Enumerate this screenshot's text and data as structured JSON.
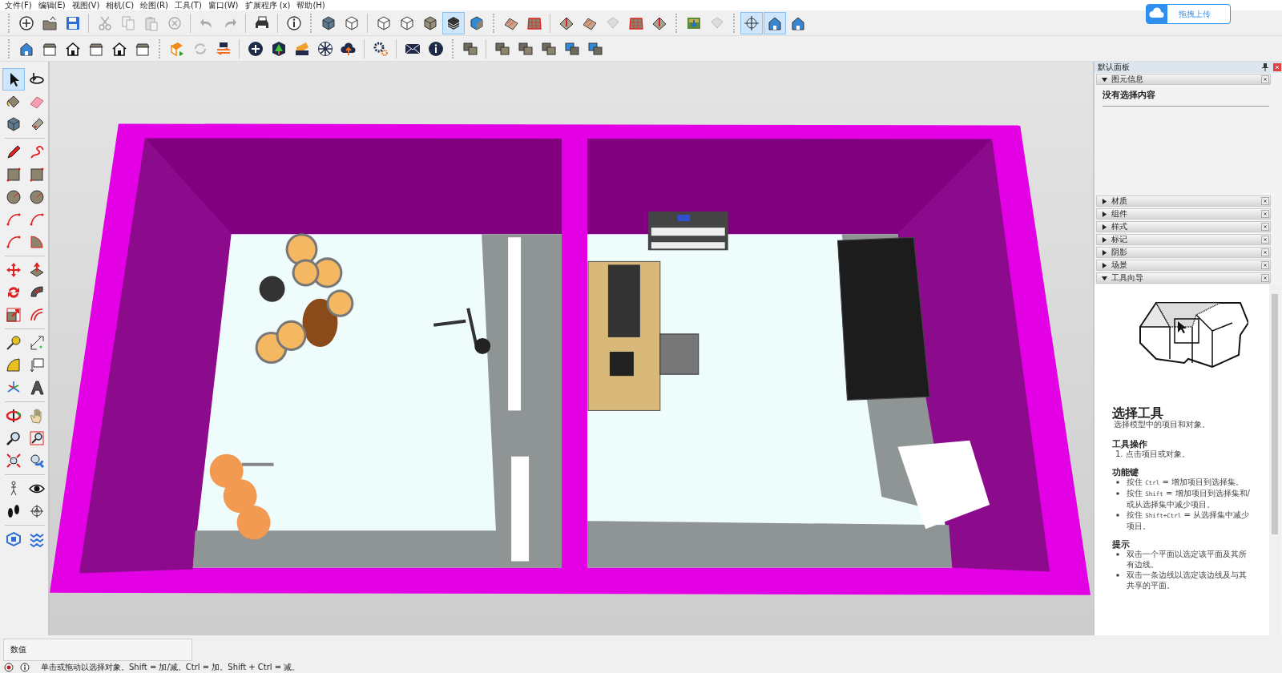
{
  "menu_bar": [
    {
      "label": "文件(F)"
    },
    {
      "label": "编辑(E)"
    },
    {
      "label": "视图(V)"
    },
    {
      "label": "相机(C)"
    },
    {
      "label": "绘图(R)"
    },
    {
      "label": "工具(T)"
    },
    {
      "label": "窗口(W)"
    },
    {
      "label": "扩展程序 (x)"
    },
    {
      "label": "帮助(H)"
    }
  ],
  "upload_button": {
    "label": "拖拽上传"
  },
  "toolbar_top": [
    {
      "selected": false
    },
    {
      "selected": false
    },
    {
      "selected": false
    },
    {
      "selected": false
    },
    {
      "selected": false
    },
    {
      "selected": false
    },
    {
      "selected": false
    },
    {
      "selected": false
    },
    {
      "selected": false
    },
    {
      "selected": false
    },
    {
      "selected": false
    },
    {
      "selected": false
    },
    {
      "selected": false
    },
    {
      "selected": false
    },
    {
      "selected": false
    },
    {
      "selected": false
    },
    {
      "selected": true
    },
    {
      "selected": false
    },
    {
      "selected": false
    },
    {
      "selected": false
    },
    {
      "selected": false
    },
    {
      "selected": false
    },
    {
      "selected": false
    },
    {
      "selected": false
    },
    {
      "selected": false
    },
    {
      "selected": false
    },
    {
      "selected": false
    },
    {
      "selected": true
    },
    {
      "selected": true
    },
    {
      "selected": false
    }
  ],
  "toolbar_bottom": [
    {
      "selected": false
    },
    {
      "selected": false
    },
    {
      "selected": false
    },
    {
      "selected": false
    },
    {
      "selected": false
    },
    {
      "selected": false
    },
    {
      "selected": false
    },
    {
      "selected": false
    },
    {
      "selected": false
    },
    {
      "selected": false
    },
    {
      "selected": false
    },
    {
      "selected": false
    },
    {
      "selected": false
    },
    {
      "selected": false
    },
    {
      "selected": false
    },
    {
      "selected": false
    },
    {
      "selected": false
    },
    {
      "selected": false
    },
    {
      "selected": false
    },
    {
      "selected": false
    },
    {
      "selected": false
    },
    {
      "selected": false
    },
    {
      "selected": false
    }
  ],
  "tool_palette": [
    {
      "selected": true
    },
    {
      "selected": false
    },
    {
      "selected": false
    },
    {
      "selected": false
    },
    {
      "selected": false
    },
    {
      "selected": false
    },
    {
      "selected": false
    },
    {
      "selected": false
    },
    {
      "selected": false
    },
    {
      "selected": false
    },
    {
      "selected": false
    },
    {
      "selected": false
    },
    {
      "selected": false
    },
    {
      "selected": false
    },
    {
      "selected": false
    },
    {
      "selected": false
    },
    {
      "selected": false
    },
    {
      "selected": false
    },
    {
      "selected": false
    },
    {
      "selected": false
    },
    {
      "selected": false
    },
    {
      "selected": false
    },
    {
      "selected": false
    },
    {
      "selected": false
    },
    {
      "selected": false
    },
    {
      "selected": false
    },
    {
      "selected": false
    },
    {
      "selected": false
    },
    {
      "selected": false
    },
    {
      "selected": false
    },
    {
      "selected": false
    },
    {
      "selected": false
    },
    {
      "selected": false
    },
    {
      "selected": false
    },
    {
      "selected": false
    },
    {
      "selected": false
    },
    {
      "selected": false
    },
    {
      "selected": false
    },
    {
      "selected": false
    },
    {
      "selected": false
    }
  ],
  "tray": {
    "title": "默认面板",
    "panels": [
      {
        "label": "图元信息",
        "expanded": true,
        "content": "没有选择内容"
      },
      {
        "label": "材质",
        "expanded": false
      },
      {
        "label": "组件",
        "expanded": false
      },
      {
        "label": "样式",
        "expanded": false
      },
      {
        "label": "标记",
        "expanded": false
      },
      {
        "label": "阴影",
        "expanded": false
      },
      {
        "label": "场景",
        "expanded": false
      },
      {
        "label": "工具向导",
        "expanded": true
      }
    ],
    "instructor": {
      "title": "选择工具",
      "subtitle": "选择模型中的项目和对象。",
      "sections": [
        {
          "heading": "工具操作",
          "kind": "numbered",
          "items": [
            {
              "text": "1. 点击项目或对象。"
            }
          ]
        },
        {
          "heading": "功能键",
          "kind": "bullets",
          "items": [
            {
              "pre": "按住 ",
              "key": "Ctrl",
              "post": " = 增加项目到选择集。"
            },
            {
              "pre": "按住 ",
              "key": "Shift",
              "post": " = 增加项目到选择集和/或从选择集中减少项目。"
            },
            {
              "pre": "按住 ",
              "key": "Shift+Ctrl",
              "post": " = 从选择集中减少项目。"
            }
          ]
        },
        {
          "heading": "提示",
          "kind": "bullets",
          "items": [
            {
              "text": "双击一个平面以选定该平面及其所有边线。"
            },
            {
              "text": "双击一条边线以选定该边线及与其共享的平面。"
            }
          ]
        }
      ]
    }
  },
  "value_box": {
    "label": "数值"
  },
  "status_bar": {
    "message": "单击或拖动以选择对象。Shift = 加/减。Ctrl = 加。Shift + Ctrl = 减。"
  }
}
